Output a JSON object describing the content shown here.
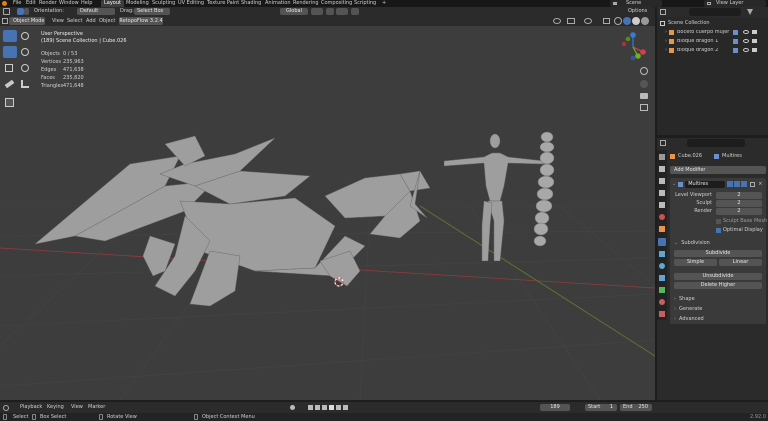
{
  "top_menu": {
    "items": [
      "File",
      "Edit",
      "Render",
      "Window",
      "Help"
    ],
    "tabs": [
      "Layout",
      "Modeling",
      "Sculpting",
      "UV Editing",
      "Texture Paint",
      "Shading",
      "Animation",
      "Rendering",
      "Compositing",
      "Scripting"
    ],
    "add_tab": "+",
    "scene_label": "Scene",
    "view_layer_label": "View Layer"
  },
  "tool_header": {
    "orientation_label": "Orientation:",
    "orientation_value": "Default",
    "drag_label": "Drag:",
    "drag_value": "Select Box",
    "transform_value": "Global",
    "options_label": "Options"
  },
  "viewport_header": {
    "mode": "Object Mode",
    "menus": [
      "View",
      "Select",
      "Add",
      "Object"
    ],
    "addon": "RetopoFlow 3.2.4"
  },
  "viewport_info": {
    "title": "User Perspective",
    "collection": "(189) Scene Collection | Cube.026",
    "stats": [
      {
        "label": "Objects",
        "value": "0 / 53"
      },
      {
        "label": "Vertices",
        "value": "235,963"
      },
      {
        "label": "Edges",
        "value": "471,638"
      },
      {
        "label": "Faces",
        "value": "235,820"
      },
      {
        "label": "Triangles",
        "value": "471,648"
      }
    ]
  },
  "outliner": {
    "root": "Scene Collection",
    "items": [
      "Boceto cuerpo mujer",
      "Bloque dragon 1",
      "Bloque dragon 2"
    ]
  },
  "properties": {
    "object_name": "Cube.026",
    "modifier_tab": "Multires",
    "add_modifier": "Add Modifier",
    "modifier_name": "Multires",
    "fields": [
      {
        "label": "Level Viewport",
        "value": "2"
      },
      {
        "label": "Sculpt",
        "value": "2"
      },
      {
        "label": "Render",
        "value": "2"
      }
    ],
    "sculpt_base_mesh": "Sculpt Base Mesh",
    "optimal_display": "Optimal Display",
    "subdivision_label": "Subdivision",
    "subdivide_btn": "Subdivide",
    "simple_btn": "Simple",
    "linear_btn": "Linear",
    "unsubdivide_btn": "Unsubdivide",
    "delete_higher_btn": "Delete Higher",
    "sections": [
      "Shape",
      "Generate",
      "Advanced"
    ]
  },
  "timeline": {
    "menus": [
      "Playback",
      "Keying",
      "View",
      "Marker"
    ],
    "current_frame": "189",
    "start_label": "Start",
    "start_value": "1",
    "end_label": "End",
    "end_value": "250"
  },
  "status_bar": {
    "select": "Select",
    "box_select": "Box Select",
    "rotate_view": "Rotate View",
    "context_menu": "Object Context Menu",
    "version": "2.92.0"
  },
  "colors": {
    "accent": "#4772b3",
    "viewport_bg": "#3d3d3d",
    "header_bg": "#232323",
    "panel_bg": "#2b2b2b",
    "axis_x": "#d53e4f",
    "axis_y": "#72b11d",
    "axis_z": "#3a78d4"
  }
}
